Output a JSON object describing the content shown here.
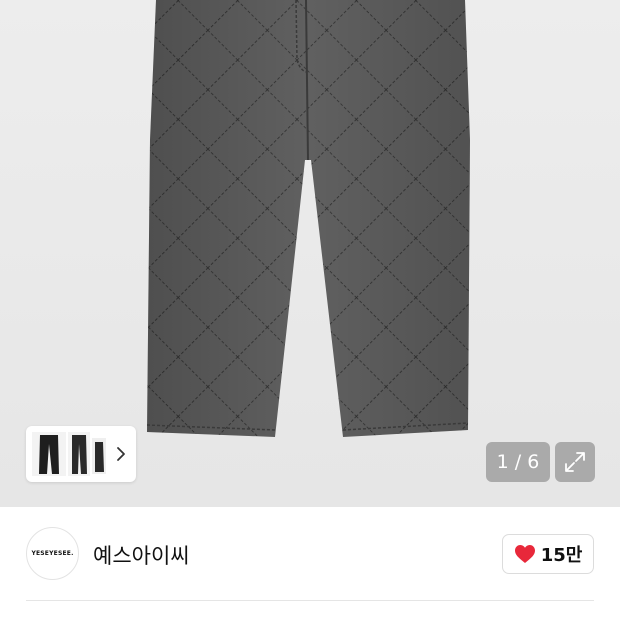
{
  "gallery": {
    "current_page": "1",
    "total_pages": "6",
    "separator": " / ",
    "product_icon": "quilted-denim-pants-image",
    "expand_icon": "expand-arrows-icon",
    "thumbnail_icon": "product-thumbnails",
    "next_icon": "chevron-right-icon"
  },
  "seller": {
    "logo_text": "YESEYESEE.",
    "name": "예스아이씨"
  },
  "like": {
    "icon": "heart-icon",
    "color": "#e8283a",
    "count": "15만"
  }
}
